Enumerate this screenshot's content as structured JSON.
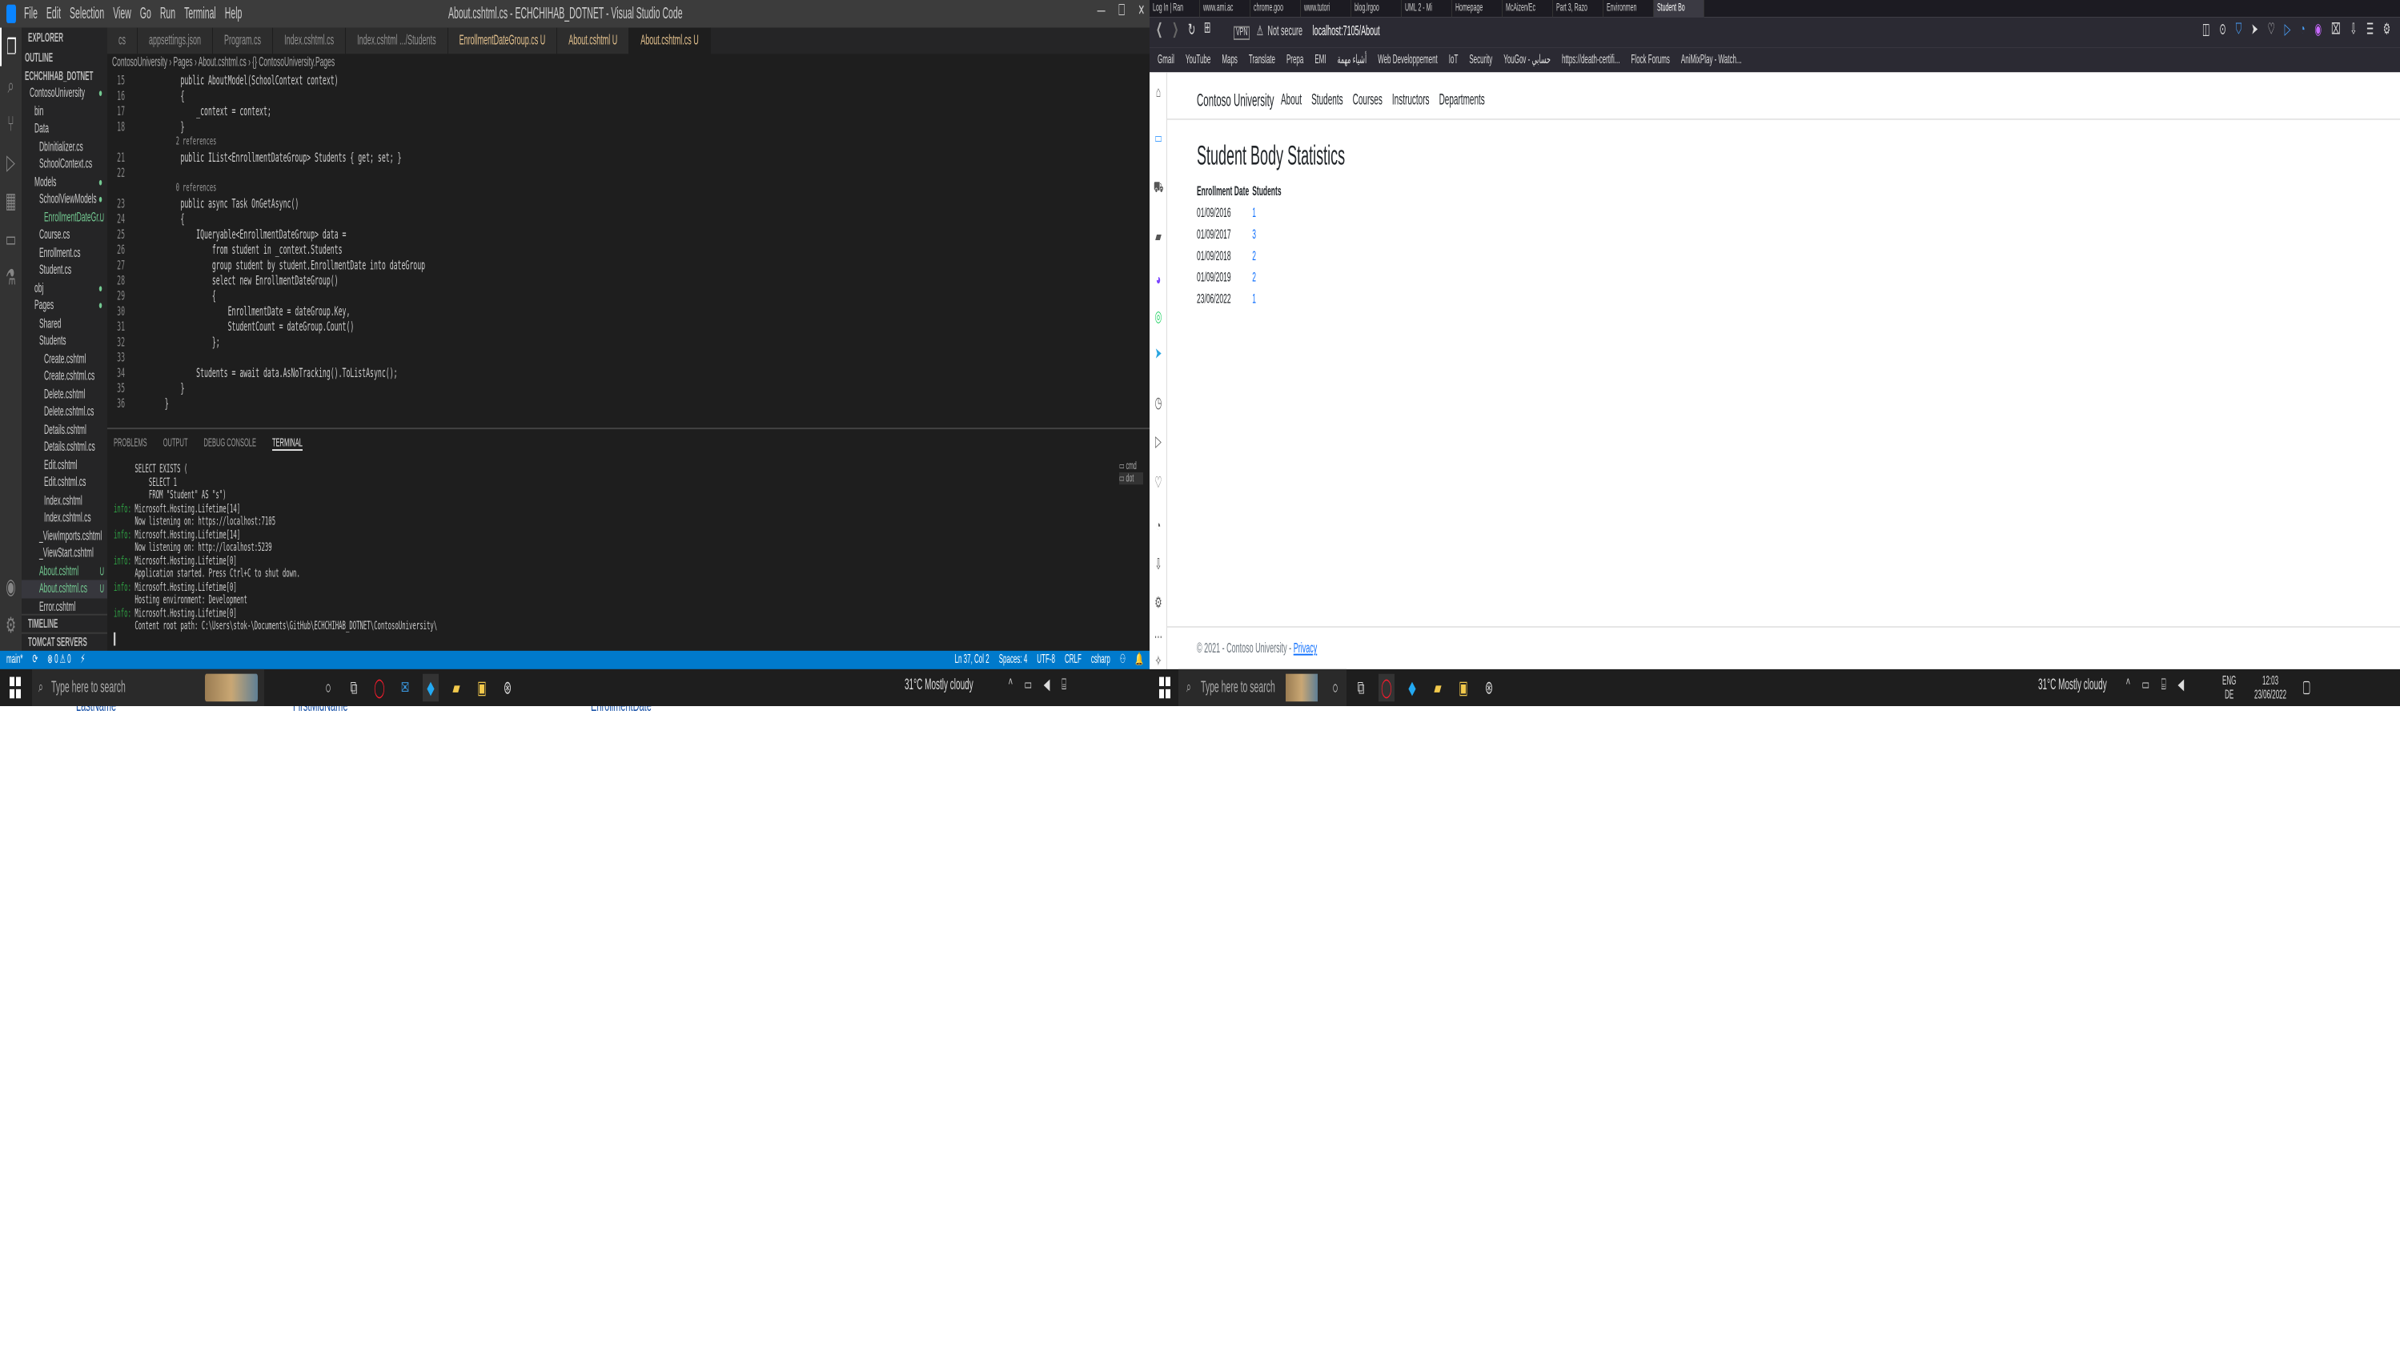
{
  "vscode": {
    "window_title": "About.cshtml.cs - ECHCHIHAB_DOTNET - Visual Studio Code",
    "menu": [
      "File",
      "Edit",
      "Selection",
      "View",
      "Go",
      "Run",
      "Terminal",
      "Help"
    ],
    "explorer_header": "EXPLORER",
    "explorer": [
      {
        "label": "OUTLINE",
        "indent": 0,
        "kind": "hdr"
      },
      {
        "label": "ECHCHIHAB_DOTNET",
        "indent": 0,
        "kind": "hdr"
      },
      {
        "label": "ContosoUniversity",
        "indent": 1,
        "mark": "●"
      },
      {
        "label": "bin",
        "indent": 2
      },
      {
        "label": "Data",
        "indent": 2
      },
      {
        "label": "DbInitializer.cs",
        "indent": 3
      },
      {
        "label": "SchoolContext.cs",
        "indent": 3
      },
      {
        "label": "Models",
        "indent": 2,
        "mark": "●"
      },
      {
        "label": "SchoolViewModels",
        "indent": 3,
        "mark": "●"
      },
      {
        "label": "EnrollmentDateGr...",
        "indent": 4,
        "mark": "U"
      },
      {
        "label": "Course.cs",
        "indent": 3
      },
      {
        "label": "Enrollment.cs",
        "indent": 3
      },
      {
        "label": "Student.cs",
        "indent": 3
      },
      {
        "label": "obj",
        "indent": 2,
        "mark": "●"
      },
      {
        "label": "Pages",
        "indent": 2,
        "mark": "●"
      },
      {
        "label": "Shared",
        "indent": 3
      },
      {
        "label": "Students",
        "indent": 3
      },
      {
        "label": "Create.cshtml",
        "indent": 4
      },
      {
        "label": "Create.cshtml.cs",
        "indent": 4
      },
      {
        "label": "Delete.cshtml",
        "indent": 4
      },
      {
        "label": "Delete.cshtml.cs",
        "indent": 4
      },
      {
        "label": "Details.cshtml",
        "indent": 4
      },
      {
        "label": "Details.cshtml.cs",
        "indent": 4
      },
      {
        "label": "Edit.cshtml",
        "indent": 4
      },
      {
        "label": "Edit.cshtml.cs",
        "indent": 4
      },
      {
        "label": "Index.cshtml",
        "indent": 4
      },
      {
        "label": "Index.cshtml.cs",
        "indent": 4
      },
      {
        "label": "_ViewImports.cshtml",
        "indent": 3
      },
      {
        "label": "_ViewStart.cshtml",
        "indent": 3
      },
      {
        "label": "About.cshtml",
        "indent": 3,
        "mark": "U"
      },
      {
        "label": "About.cshtml.cs",
        "indent": 3,
        "mark": "U",
        "selected": true
      },
      {
        "label": "Error.cshtml",
        "indent": 3
      }
    ],
    "timeline": "TIMELINE",
    "tomcat": "TOMCAT SERVERS",
    "tabs": [
      {
        "label": "cs",
        "active": false
      },
      {
        "label": "appsettings.json",
        "active": false
      },
      {
        "label": "Program.cs",
        "active": false
      },
      {
        "label": "Index.cshtml.cs",
        "active": false
      },
      {
        "label": "Index.cshtml .../Students",
        "active": false
      },
      {
        "label": "EnrollmentDateGroup.cs U",
        "active": false,
        "modified": true
      },
      {
        "label": "About.cshtml U",
        "active": false,
        "modified": true
      },
      {
        "label": "About.cshtml.cs U",
        "active": true,
        "modified": true
      }
    ],
    "breadcrumb": "ContosoUniversity › Pages › About.cshtml.cs › {} ContosoUniversity.Pages",
    "code": [
      {
        "n": "15",
        "t": "public AboutModel(SchoolContext context)",
        "indent": 8
      },
      {
        "n": "16",
        "t": "{",
        "indent": 8
      },
      {
        "n": "17",
        "t": "_context = context;",
        "indent": 12
      },
      {
        "n": "18",
        "t": "}",
        "indent": 8
      },
      {
        "n": "",
        "t": "2 references",
        "indent": 8,
        "lens": true
      },
      {
        "n": "21",
        "t": "public IList<EnrollmentDateGroup> Students { get; set; }",
        "indent": 8
      },
      {
        "n": "22",
        "t": "",
        "indent": 0
      },
      {
        "n": "",
        "t": "0 references",
        "indent": 8,
        "lens": true
      },
      {
        "n": "23",
        "t": "public async Task OnGetAsync()",
        "indent": 8
      },
      {
        "n": "24",
        "t": "{",
        "indent": 8
      },
      {
        "n": "25",
        "t": "IQueryable<EnrollmentDateGroup> data =",
        "indent": 12
      },
      {
        "n": "26",
        "t": "from student in _context.Students",
        "indent": 16
      },
      {
        "n": "27",
        "t": "group student by student.EnrollmentDate into dateGroup",
        "indent": 16
      },
      {
        "n": "28",
        "t": "select new EnrollmentDateGroup()",
        "indent": 16
      },
      {
        "n": "29",
        "t": "{",
        "indent": 16
      },
      {
        "n": "30",
        "t": "EnrollmentDate = dateGroup.Key,",
        "indent": 20
      },
      {
        "n": "31",
        "t": "StudentCount = dateGroup.Count()",
        "indent": 20
      },
      {
        "n": "32",
        "t": "};",
        "indent": 16
      },
      {
        "n": "33",
        "t": "",
        "indent": 0
      },
      {
        "n": "34",
        "t": "Students = await data.AsNoTracking().ToListAsync();",
        "indent": 12
      },
      {
        "n": "35",
        "t": "}",
        "indent": 8
      },
      {
        "n": "36",
        "t": "}",
        "indent": 4
      }
    ],
    "panel_tabs": [
      "PROBLEMS",
      "OUTPUT",
      "DEBUG CONSOLE",
      "TERMINAL"
    ],
    "terminal": [
      {
        "p": "",
        "t": "      SELECT EXISTS ("
      },
      {
        "p": "",
        "t": "          SELECT 1"
      },
      {
        "p": "",
        "t": "          FROM \"Student\" AS \"s\")"
      },
      {
        "p": "info:",
        "t": " Microsoft.Hosting.Lifetime[14]"
      },
      {
        "p": "",
        "t": "      Now listening on: https://localhost:7105"
      },
      {
        "p": "info:",
        "t": " Microsoft.Hosting.Lifetime[14]"
      },
      {
        "p": "",
        "t": "      Now listening on: http://localhost:5239"
      },
      {
        "p": "info:",
        "t": " Microsoft.Hosting.Lifetime[0]"
      },
      {
        "p": "",
        "t": "      Application started. Press Ctrl+C to shut down."
      },
      {
        "p": "info:",
        "t": " Microsoft.Hosting.Lifetime[0]"
      },
      {
        "p": "",
        "t": "      Hosting environment: Development"
      },
      {
        "p": "info:",
        "t": " Microsoft.Hosting.Lifetime[0]"
      },
      {
        "p": "",
        "t": "      Content root path: C:\\Users\\stok-\\Documents\\GitHub\\ECHCHIHAB_DOTNET\\ContosoUniversity\\"
      },
      {
        "p": "",
        "t": "▌"
      }
    ],
    "status_left": [
      "main*",
      "⟳",
      "⊗ 0 ⚠ 0",
      "⚡"
    ],
    "status_right": [
      "Ln 37, Col 2",
      "Spaces: 4",
      "UTF-8",
      "CRLF",
      "csharp",
      "⚇",
      "🔔"
    ]
  },
  "taskbar_left": {
    "search_placeholder": "Type here to search",
    "weather": "31°C  Mostly cloudy"
  },
  "below_page": [
    "LastName",
    "FirstMidName",
    "EnrollmentDate"
  ],
  "browser": {
    "tabs": [
      {
        "label": "Log In | Ran",
        "active": false
      },
      {
        "label": "www.ami.ac",
        "active": false
      },
      {
        "label": "chrome.goo",
        "active": false
      },
      {
        "label": "www.tutori",
        "active": false
      },
      {
        "label": "blog.lrgoo",
        "active": false
      },
      {
        "label": "UML 2 - Mi",
        "active": false
      },
      {
        "label": "Homepage",
        "active": false
      },
      {
        "label": "McAizen/Ec",
        "active": false
      },
      {
        "label": "Part 3, Razo",
        "active": false
      },
      {
        "label": "Environmen",
        "active": false
      },
      {
        "label": "Student Bo",
        "active": true
      }
    ],
    "security": "Not secure",
    "url": "localhost:7105/About",
    "bookmarks": [
      "Gmail",
      "YouTube",
      "Maps",
      "Translate",
      "Prepa",
      "EMI",
      "أشياء مهمة",
      "Web Developpement",
      "IoT",
      "Security",
      "YouGov - حسابي",
      "https://death-certifi...",
      "Flock Forums",
      "AniMixPlay - Watch..."
    ],
    "site": {
      "brand": "Contoso University",
      "nav": [
        "About",
        "Students",
        "Courses",
        "Instructors",
        "Departments"
      ],
      "title": "Student Body Statistics",
      "table": {
        "headers": [
          "Enrollment Date",
          "Students"
        ],
        "rows": [
          [
            "01/09/2016",
            "1"
          ],
          [
            "01/09/2017",
            "3"
          ],
          [
            "01/09/2018",
            "2"
          ],
          [
            "01/09/2019",
            "2"
          ],
          [
            "23/06/2022",
            "1"
          ]
        ]
      },
      "footer_text": "© 2021 - Contoso University -",
      "footer_link": "Privacy"
    }
  },
  "taskbar_right": {
    "search_placeholder": "Type here to search",
    "weather": "31°C  Mostly cloudy",
    "lang": "ENG",
    "lang2": "DE",
    "time": "12:03",
    "date": "23/06/2022"
  }
}
